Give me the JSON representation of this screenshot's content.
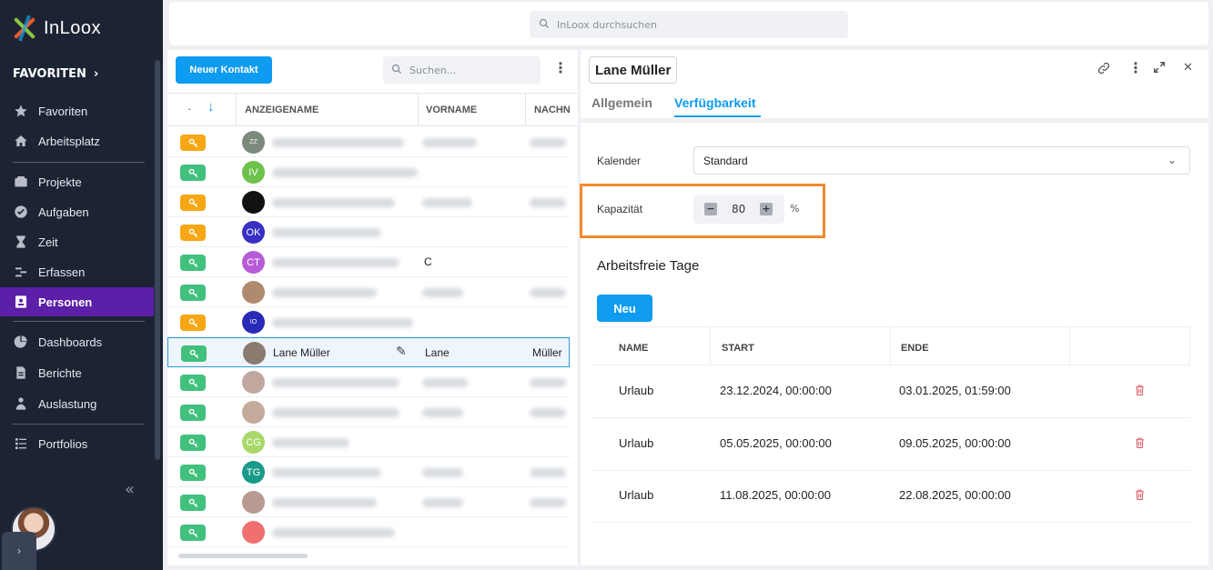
{
  "app": {
    "brand": "InLoox",
    "colors": {
      "primary": "#0e9bf0",
      "sidebar": "#1c2434",
      "active_nav": "#5b1fa8",
      "highlight": "#f28a2e"
    }
  },
  "sidebar": {
    "favorites_label": "FAVORITEN",
    "items": [
      {
        "label": "Favoriten",
        "icon": "star-icon"
      },
      {
        "label": "Arbeitsplatz",
        "icon": "home-icon"
      },
      {
        "label": "Projekte",
        "icon": "folder-icon"
      },
      {
        "label": "Aufgaben",
        "icon": "check-circle-icon"
      },
      {
        "label": "Zeit",
        "icon": "hourglass-icon"
      },
      {
        "label": "Erfassen",
        "icon": "track-icon"
      },
      {
        "label": "Personen",
        "icon": "contacts-icon"
      },
      {
        "label": "Dashboards",
        "icon": "pie-chart-icon"
      },
      {
        "label": "Berichte",
        "icon": "report-icon"
      },
      {
        "label": "Auslastung",
        "icon": "workload-icon"
      },
      {
        "label": "Portfolios",
        "icon": "portfolio-icon"
      }
    ]
  },
  "topbar": {
    "search_placeholder": "InLoox durchsuchen"
  },
  "list": {
    "new_button": "Neuer Kontakt",
    "search_placeholder": "Suchen...",
    "columns": {
      "display_name": "ANZEIGENAME",
      "first_name": "VORNAME",
      "last_name": "NACHN"
    },
    "rows": [
      {
        "badge": "orange",
        "avatar_text": "ZZ",
        "avatar_color": "#7b8a7a"
      },
      {
        "badge": "green",
        "avatar_text": "IV",
        "avatar_color": "#6cc24a"
      },
      {
        "badge": "orange",
        "avatar_text": "",
        "avatar_color": "#111111"
      },
      {
        "badge": "orange",
        "avatar_text": "OK",
        "avatar_color": "#3a2fc4"
      },
      {
        "badge": "green",
        "avatar_text": "CT",
        "avatar_color": "#b65bd6",
        "first_name": "C"
      },
      {
        "badge": "green",
        "avatar_text": "",
        "avatar_color": "#b08a6e"
      },
      {
        "badge": "orange",
        "avatar_text": "IO",
        "avatar_color": "#2a2ab8"
      },
      {
        "badge": "green",
        "avatar_text": "",
        "avatar_color": "#8a7a70",
        "display_name": "Lane Müller",
        "first_name": "Lane",
        "last_name": "Müller",
        "selected": true
      },
      {
        "badge": "green",
        "avatar_text": "",
        "avatar_color": "#c0a8a0"
      },
      {
        "badge": "green",
        "avatar_text": "",
        "avatar_color": "#c4aa9a"
      },
      {
        "badge": "green",
        "avatar_text": "CG",
        "avatar_color": "#a8d86a"
      },
      {
        "badge": "green",
        "avatar_text": "TG",
        "avatar_color": "#1a9a8a"
      },
      {
        "badge": "green",
        "avatar_text": "",
        "avatar_color": "#b89a92"
      },
      {
        "badge": "green",
        "avatar_text": "",
        "avatar_color": "#f07070"
      }
    ]
  },
  "detail": {
    "title": "Lane Müller",
    "tabs": [
      "Allgemein",
      "Verfügbarkeit"
    ],
    "calendar_label": "Kalender",
    "calendar_value": "Standard",
    "capacity_label": "Kapazität",
    "capacity_value": "80",
    "capacity_unit": "%",
    "nonworking_title": "Arbeitsfreie Tage",
    "new_button": "Neu",
    "table_headers": {
      "name": "NAME",
      "start": "START",
      "end": "ENDE"
    },
    "entries": [
      {
        "name": "Urlaub",
        "start": "23.12.2024, 00:00:00",
        "end": "03.01.2025, 01:59:00"
      },
      {
        "name": "Urlaub",
        "start": "05.05.2025, 00:00:00",
        "end": "09.05.2025, 00:00:00"
      },
      {
        "name": "Urlaub",
        "start": "11.08.2025, 00:00:00",
        "end": "22.08.2025, 00:00:00"
      }
    ]
  }
}
